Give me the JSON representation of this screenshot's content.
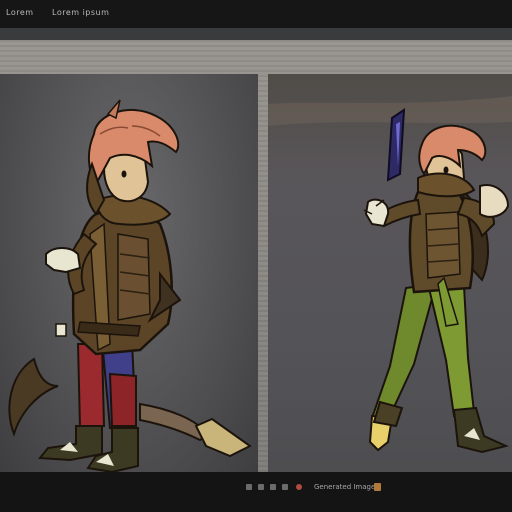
{
  "titlebar": {
    "left_text": "Lorem",
    "right_text": "Lorem ipsum"
  },
  "panels": [
    {
      "id": "left",
      "subject": "character-front-pose"
    },
    {
      "id": "right",
      "subject": "character-action-pose"
    }
  ],
  "footer": {
    "label": "Generated Images"
  },
  "icons": [
    "bookmark-icon",
    "share-icon",
    "record-icon",
    "grid-icon",
    "expand-icon",
    "save-icon"
  ]
}
